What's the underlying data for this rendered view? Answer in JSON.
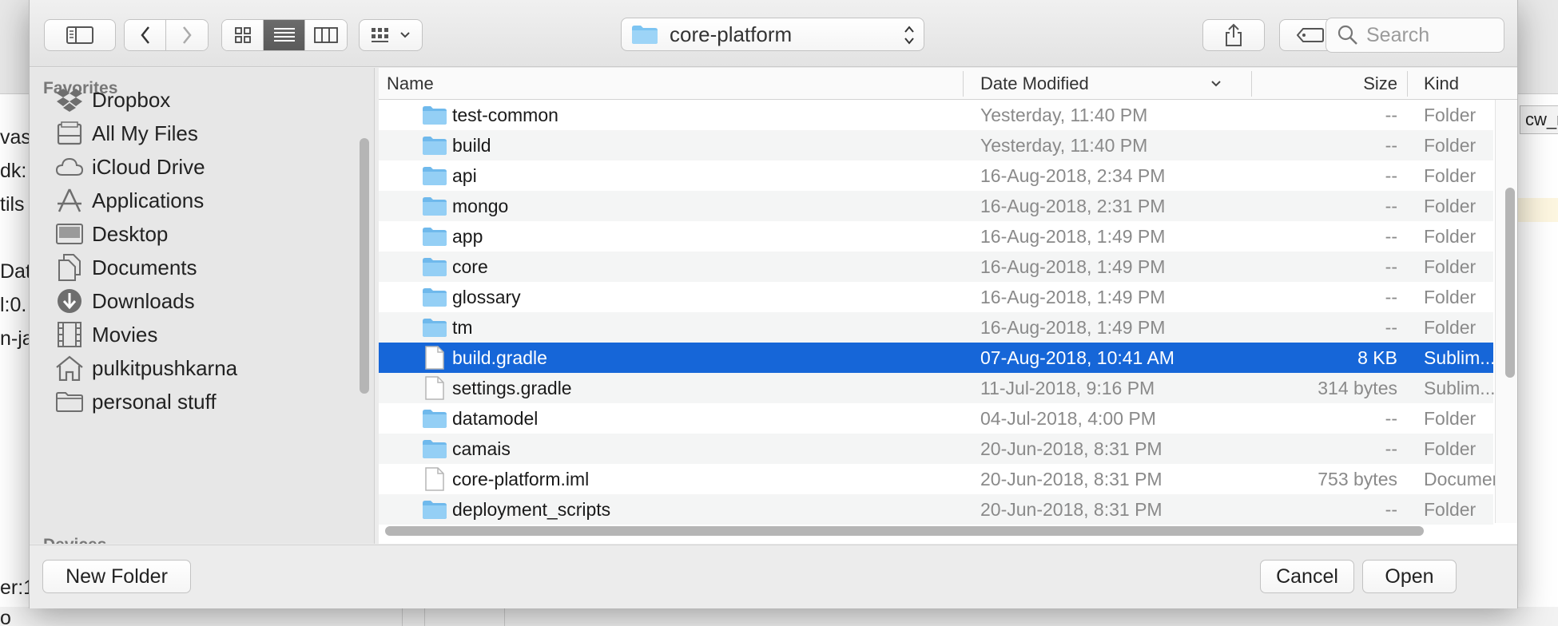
{
  "background": {
    "left_fragments": [
      "vas",
      "dk:",
      "tils",
      "Dat",
      "l:0.",
      "n-ja"
    ],
    "right_tab_fragment": "cw_m",
    "bottom_fragments": [
      "er:1",
      "o"
    ]
  },
  "toolbar": {
    "back_icon": "chevron-left-icon",
    "forward_icon": "chevron-right-icon",
    "location": "core-platform",
    "search_placeholder": "Search"
  },
  "sidebar": {
    "section_title": "Favorites",
    "next_section_title": "Devices",
    "items": [
      {
        "label": "Dropbox",
        "icon": "dropbox-icon"
      },
      {
        "label": "All My Files",
        "icon": "all-files-icon"
      },
      {
        "label": "iCloud Drive",
        "icon": "cloud-icon"
      },
      {
        "label": "Applications",
        "icon": "applications-icon"
      },
      {
        "label": "Desktop",
        "icon": "desktop-icon"
      },
      {
        "label": "Documents",
        "icon": "documents-icon"
      },
      {
        "label": "Downloads",
        "icon": "downloads-icon"
      },
      {
        "label": "Movies",
        "icon": "movies-icon"
      },
      {
        "label": "pulkitpushkarna",
        "icon": "home-icon"
      },
      {
        "label": "personal stuff",
        "icon": "folder-icon"
      }
    ]
  },
  "file_list": {
    "columns": {
      "name": "Name",
      "date": "Date Modified",
      "size": "Size",
      "kind": "Kind"
    },
    "rows": [
      {
        "name": "test-common",
        "date": "Yesterday, 11:40 PM",
        "size": "--",
        "kind": "Folder",
        "type": "folder"
      },
      {
        "name": "build",
        "date": "Yesterday, 11:40 PM",
        "size": "--",
        "kind": "Folder",
        "type": "folder"
      },
      {
        "name": "api",
        "date": "16-Aug-2018, 2:34 PM",
        "size": "--",
        "kind": "Folder",
        "type": "folder"
      },
      {
        "name": "mongo",
        "date": "16-Aug-2018, 2:31 PM",
        "size": "--",
        "kind": "Folder",
        "type": "folder"
      },
      {
        "name": "app",
        "date": "16-Aug-2018, 1:49 PM",
        "size": "--",
        "kind": "Folder",
        "type": "folder"
      },
      {
        "name": "core",
        "date": "16-Aug-2018, 1:49 PM",
        "size": "--",
        "kind": "Folder",
        "type": "folder"
      },
      {
        "name": "glossary",
        "date": "16-Aug-2018, 1:49 PM",
        "size": "--",
        "kind": "Folder",
        "type": "folder"
      },
      {
        "name": "tm",
        "date": "16-Aug-2018, 1:49 PM",
        "size": "--",
        "kind": "Folder",
        "type": "folder"
      },
      {
        "name": "build.gradle",
        "date": "07-Aug-2018, 10:41 AM",
        "size": "8 KB",
        "kind": "Sublim...un",
        "type": "file",
        "selected": true
      },
      {
        "name": "settings.gradle",
        "date": "11-Jul-2018, 9:16 PM",
        "size": "314 bytes",
        "kind": "Sublim...un",
        "type": "file"
      },
      {
        "name": "datamodel",
        "date": "04-Jul-2018, 4:00 PM",
        "size": "--",
        "kind": "Folder",
        "type": "folder"
      },
      {
        "name": "camais",
        "date": "20-Jun-2018, 8:31 PM",
        "size": "--",
        "kind": "Folder",
        "type": "folder"
      },
      {
        "name": "core-platform.iml",
        "date": "20-Jun-2018, 8:31 PM",
        "size": "753 bytes",
        "kind": "Document",
        "type": "file"
      },
      {
        "name": "deployment_scripts",
        "date": "20-Jun-2018, 8:31 PM",
        "size": "--",
        "kind": "Folder",
        "type": "folder"
      }
    ]
  },
  "buttons": {
    "new_folder": "New Folder",
    "cancel": "Cancel",
    "open": "Open"
  },
  "colors": {
    "selection": "#1666d8",
    "folder": "#7cc4f2",
    "dialog_bg": "#ececec"
  }
}
